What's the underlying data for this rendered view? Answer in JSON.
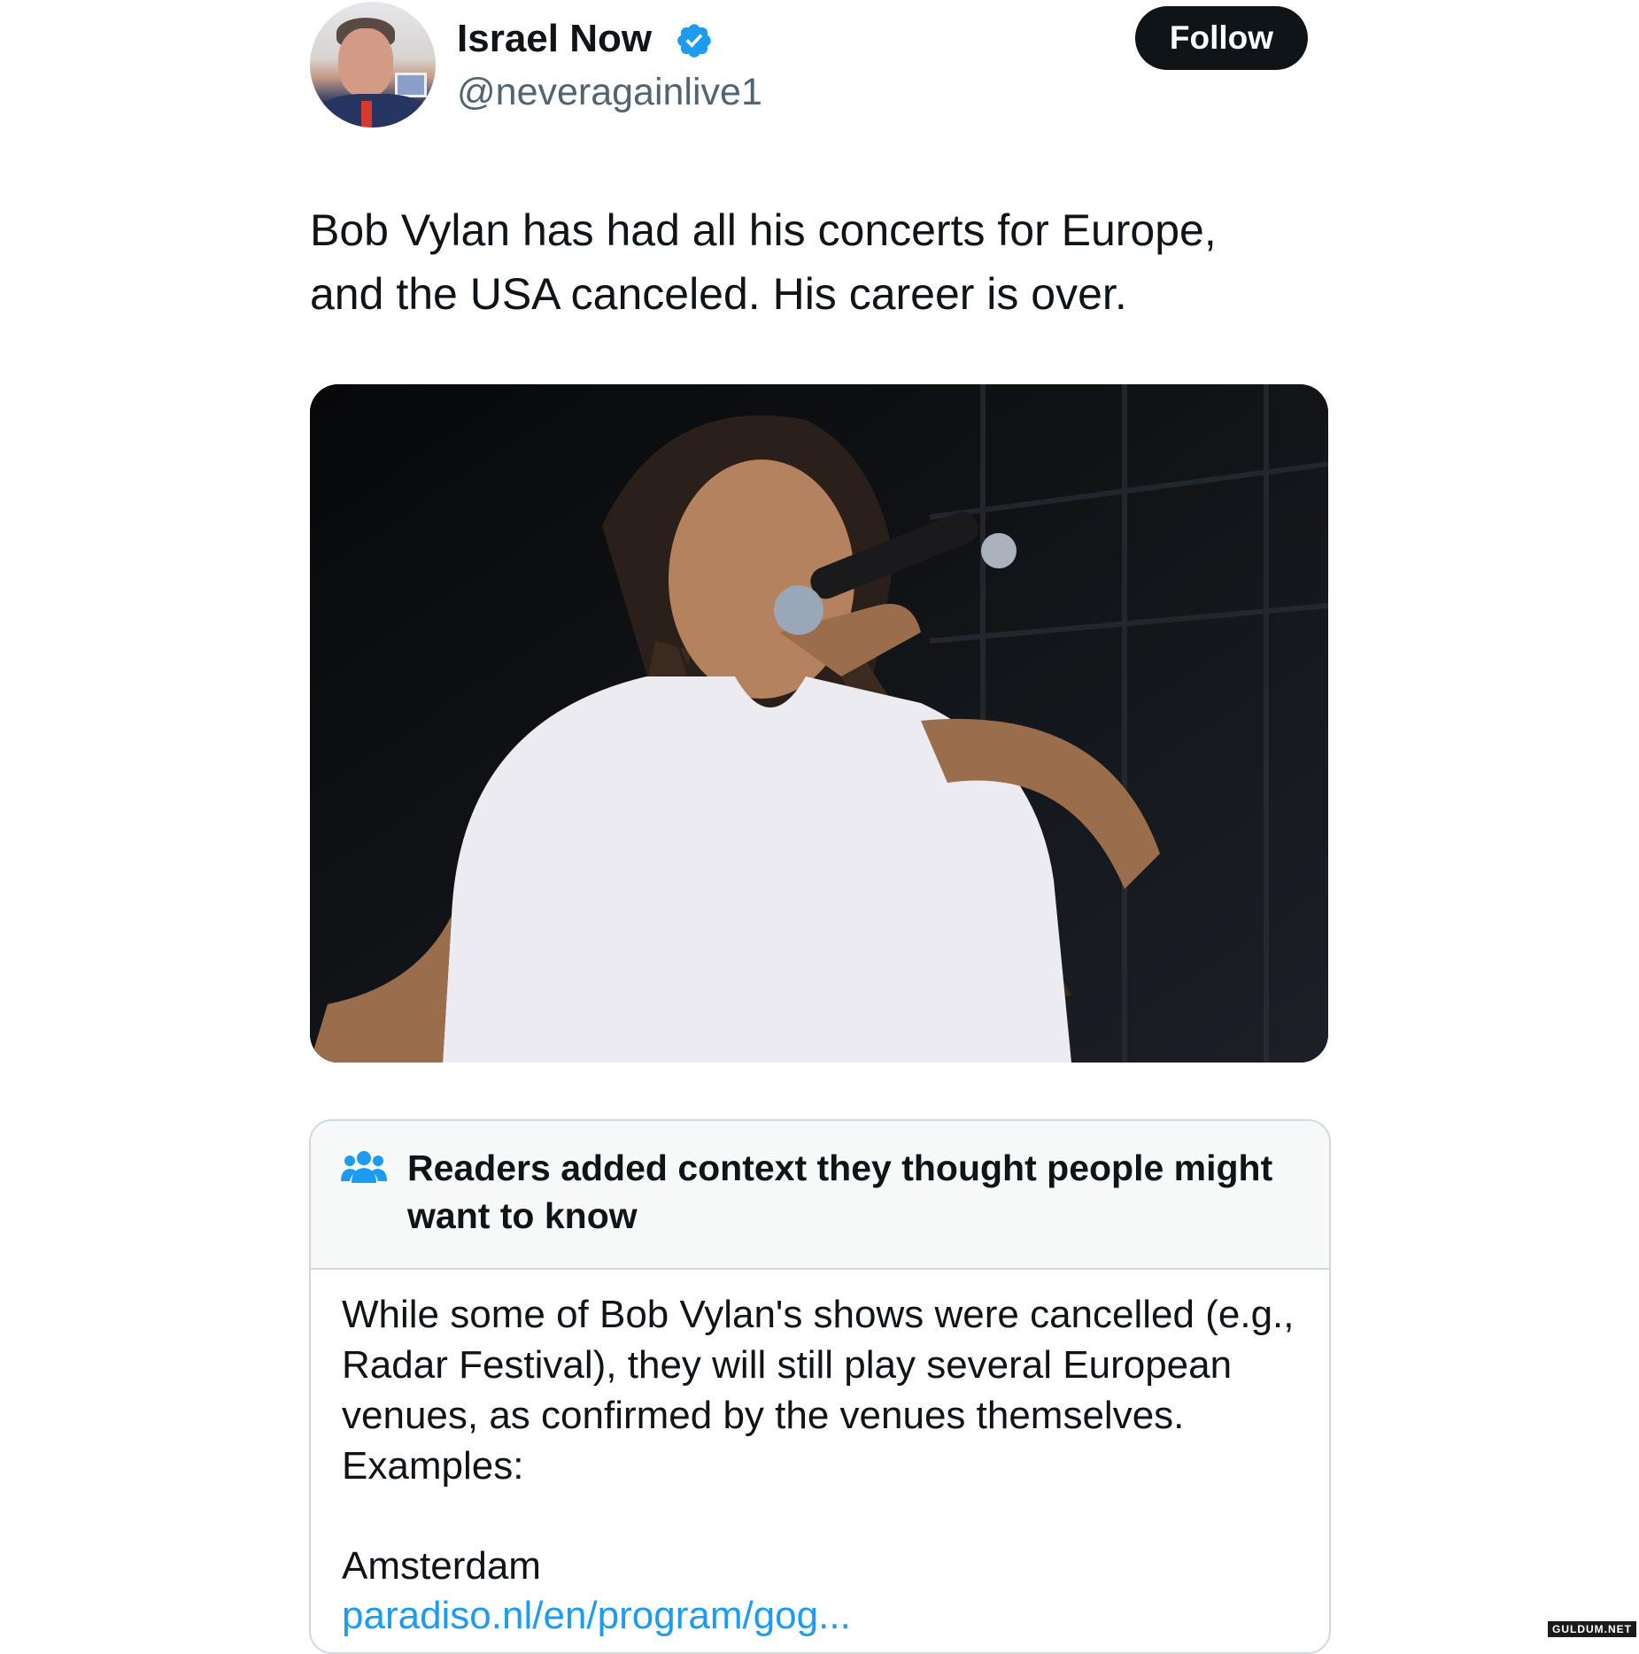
{
  "author": {
    "display_name": "Israel Now",
    "handle": "@neveragainlive1",
    "verified_icon": "verified-badge-icon",
    "verified_color": "#1d9bf0"
  },
  "follow_button": {
    "label": "Follow"
  },
  "tweet": {
    "text": "Bob Vylan has had all his concerts for Europe,\nand the USA canceled.  His career is over."
  },
  "media": {
    "icon": "photo"
  },
  "community_note": {
    "icon": "people-icon",
    "title": "Readers added context they thought people might want to know",
    "body": "While some of Bob Vylan's shows were cancelled (e.g., Radar Festival), they will still play several European venues, as confirmed by the venues themselves. Examples:",
    "city": "Amsterdam",
    "link_text": "paradiso.nl/en/program/gog..."
  },
  "watermark": {
    "text": "GULDUM.NET"
  },
  "colors": {
    "text_primary": "#0f1419",
    "text_secondary": "#536471",
    "link": "#1d9bf0",
    "note_header_bg": "#f7f9f9",
    "border": "#cfd9de"
  }
}
